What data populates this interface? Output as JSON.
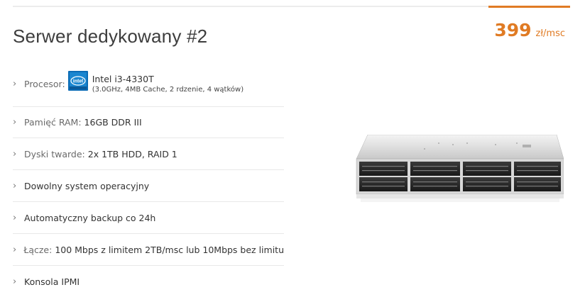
{
  "product": {
    "title": "Serwer dedykowany #2",
    "price_amount": "399",
    "price_unit": "zł/msc"
  },
  "specs": {
    "cpu": {
      "label": "Procesor:",
      "name": "Intel i3-4330T",
      "details": "(3.0GHz, 4MB Cache, 2 rdzenie, 4 wątków)",
      "logo_icon": "intel-logo-icon"
    },
    "ram": {
      "label": "Pamięć RAM:",
      "value": " 16GB DDR III"
    },
    "disks": {
      "label": "Dyski twarde:",
      "value": " 2x 1TB HDD, RAID 1"
    },
    "os": {
      "value": "Dowolny system operacyjny"
    },
    "backup": {
      "value": "Automatyczny backup co 24h"
    },
    "link": {
      "label": "Łącze:",
      "value": " 100 Mbps z limitem 2TB/msc lub 10Mbps bez limitu"
    },
    "ipmi": {
      "value": "Konsola IPMI"
    }
  },
  "icons": {
    "bullet": "chevron-right-icon"
  },
  "colors": {
    "accent": "#e07b24",
    "divider": "#e8e8e8",
    "intel_blue": "#0b6bb5"
  }
}
